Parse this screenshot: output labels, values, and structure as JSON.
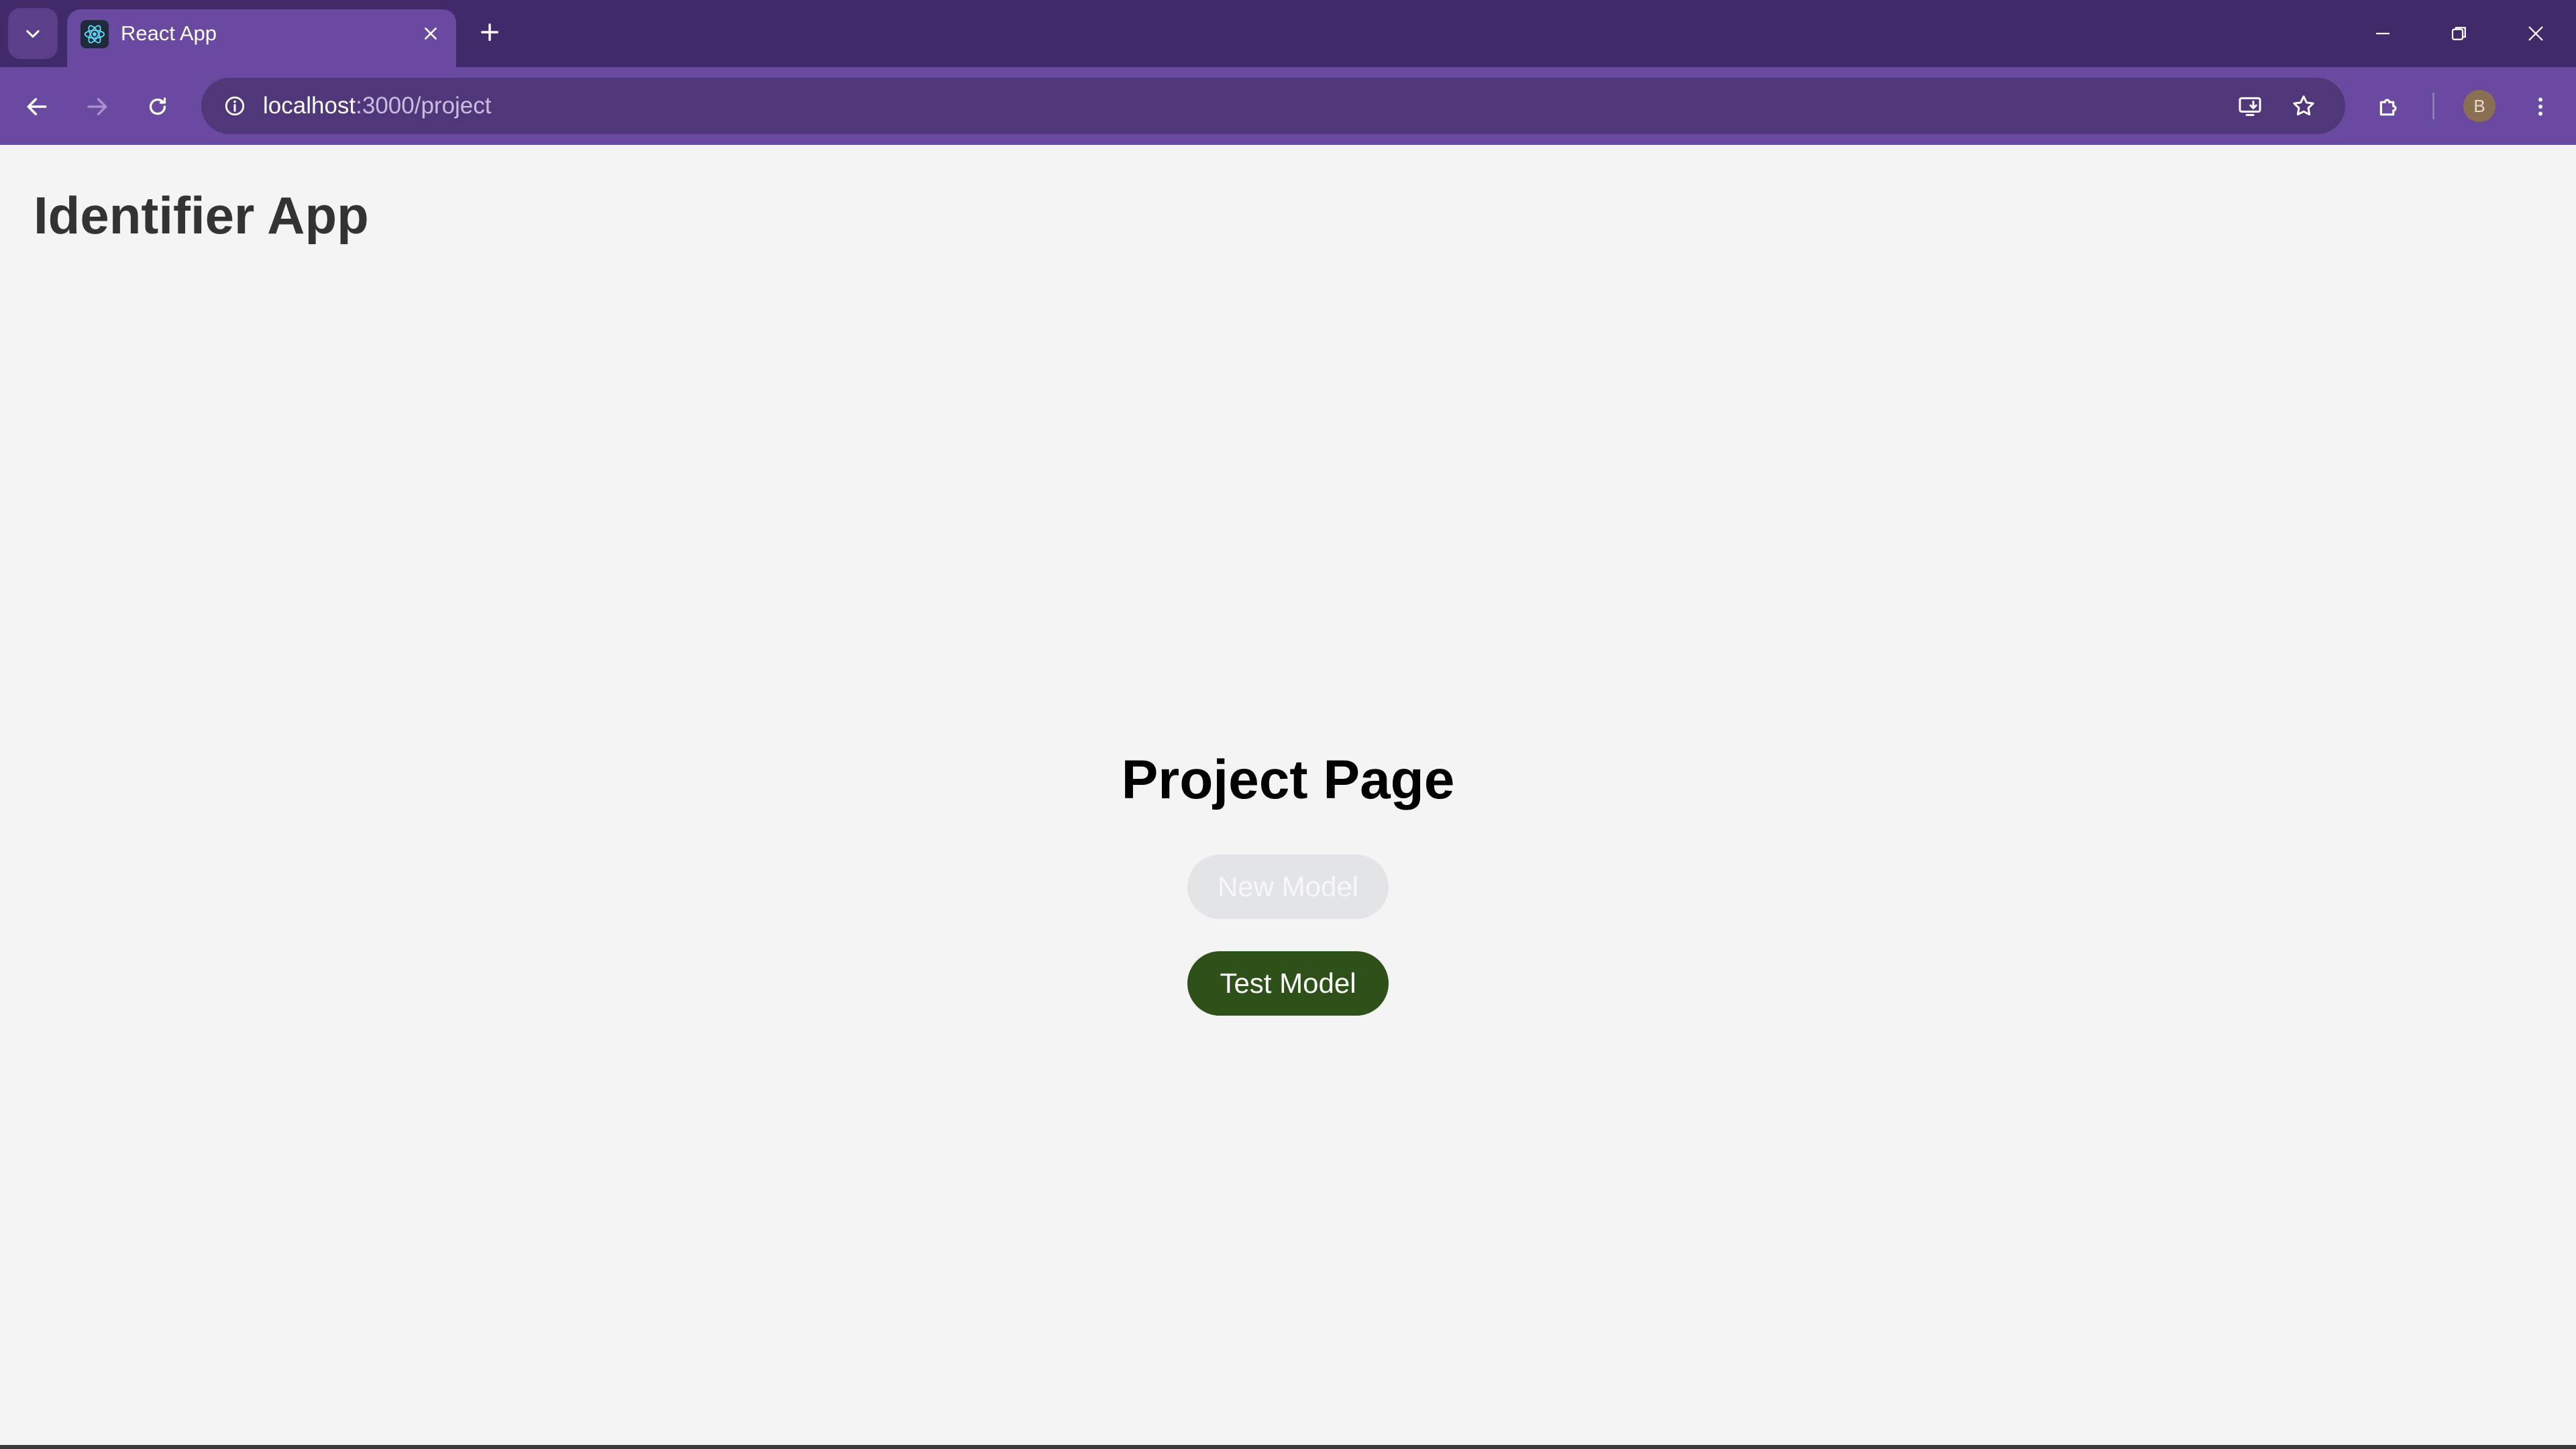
{
  "browser": {
    "tab": {
      "title": "React App"
    },
    "url": {
      "host": "localhost",
      "path": ":3000/project"
    },
    "profile_initial": "B",
    "accent_color": "#6a4aa0"
  },
  "app": {
    "title": "Identifier App",
    "heading": "Project Page",
    "buttons": {
      "new_model": "New Model",
      "test_model": "Test Model"
    },
    "colors": {
      "test_button": "#2d5119",
      "new_button_disabled": "#e2e4e7"
    }
  }
}
